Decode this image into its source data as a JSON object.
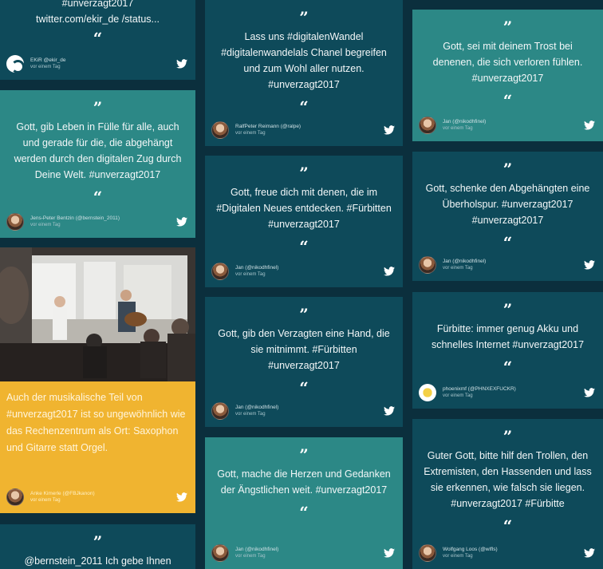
{
  "twitter_icon": "twitter-bird-icon",
  "colors": {
    "background": "#0b2f3d",
    "dark_card": "#0e4a5a",
    "teal_card": "#2c8886",
    "yellow_card": "#f0b430"
  },
  "quote_open": "”",
  "quote_close": "“",
  "col1": [
    {
      "text": "#unverzagt2017 twitter.com/ekir_de /status...",
      "author": "EKiR @ekir_de",
      "time": "vor einem Tag"
    },
    {
      "text": "Gott, gib Leben in Fülle für alle, auch und gerade für die, die abgehängt werden durch den digitalen Zug durch Deine Welt. #unverzagt2017",
      "author": "Jens-Peter Bentzin (@bernstein_2011)",
      "time": "vor einem Tag"
    },
    {
      "text": "Auch der musikalische Teil von #unverzagt2017 ist so ungewöhnlich wie das Rechenzentrum als Ort: Saxophon und Gitarre statt Orgel.",
      "author": "Anke Kimerle (@FBJkanon)",
      "time": "vor einem Tag"
    },
    {
      "text": "@bernstein_2011 Ich gebe Ihnen"
    }
  ],
  "col2": [
    {
      "text": "Lass uns #digitalenWandel #digitalenwandelals Chanel begreifen und zum Wohl aller nutzen. #unverzagt2017",
      "author": "RalfPeter Reimann (@ralpe)",
      "time": "vor einem Tag"
    },
    {
      "text": "Gott, freue dich mit denen, die im #Digitalen Neues entdecken. #Fürbitten #unverzagt2017",
      "author": "Jan (@nikodhfinel)",
      "time": "vor einem Tag"
    },
    {
      "text": "Gott, gib den Verzagten eine Hand, die sie mitnimmt. #Fürbitten #unverzagt2017",
      "author": "Jan (@nikodhfinel)",
      "time": "vor einem Tag"
    },
    {
      "text": "Gott, mache die Herzen und Gedanken der Ängstlichen weit. #unverzagt2017",
      "author": "Jan (@nikodhfinel)",
      "time": "vor einem Tag"
    }
  ],
  "col3": [
    {
      "text": "Gott, sei mit deinem Trost bei denenen, die sich verloren fühlen. #unverzagt2017",
      "author": "Jan (@nikodhfinel)",
      "time": "vor einem Tag"
    },
    {
      "text": "Gott, schenke den Abgehängten eine Überholspur. #unverzagt2017 #unverzagt2017",
      "author": "Jan (@nikodhfinel)",
      "time": "vor einem Tag"
    },
    {
      "text": "Fürbitte: immer genug Akku und schnelles Internet #unverzagt2017",
      "author": "phoenixmf (@PHNXEXFUCKR)",
      "time": "vor einem Tag"
    },
    {
      "text": "Guter Gott, bitte hilf den Trollen, den Extremisten, den Hassenden und lass sie erkennen, wie falsch sie liegen. #unverzagt2017 #Fürbitte",
      "author": "Wolfgang Loos (@wlfls)",
      "time": "vor einem Tag"
    }
  ]
}
